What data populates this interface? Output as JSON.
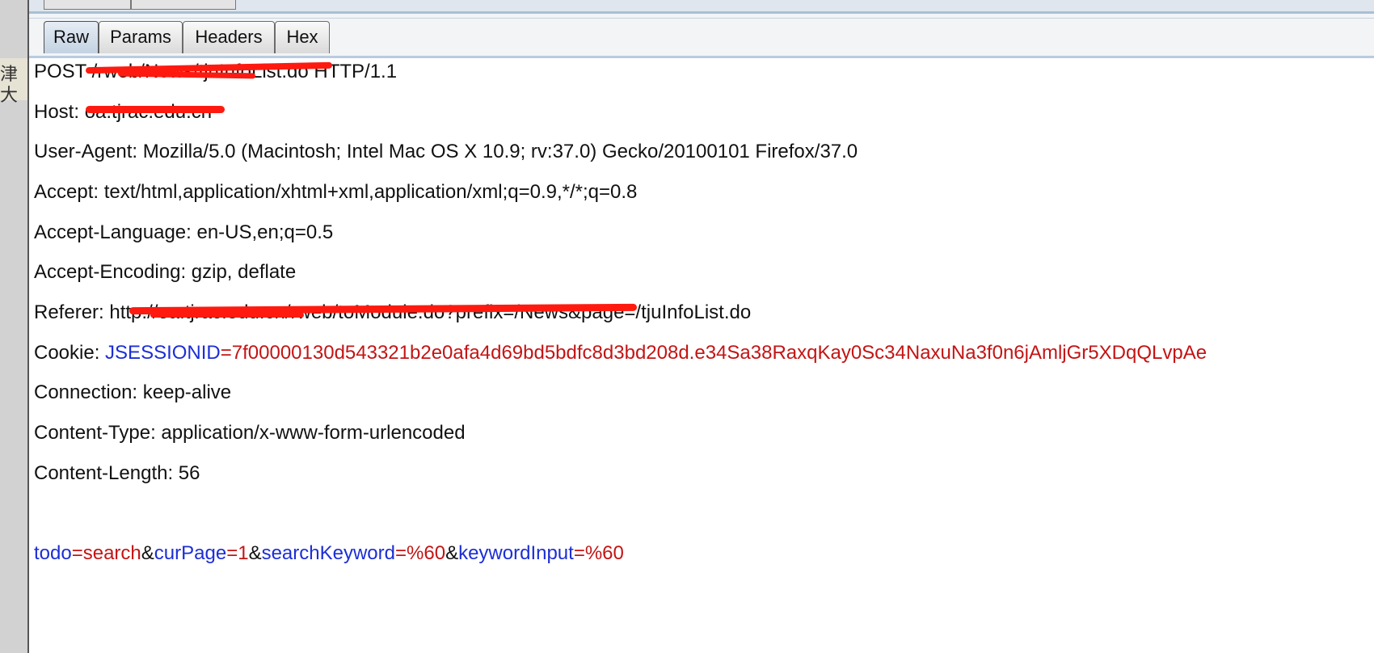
{
  "window": {
    "side_glyph": "津大"
  },
  "tabs": [
    {
      "label": "Raw",
      "active": true
    },
    {
      "label": "Params",
      "active": false
    },
    {
      "label": "Headers",
      "active": false
    },
    {
      "label": "Hex",
      "active": false
    }
  ],
  "request": {
    "request_line": {
      "method": "POST /",
      "redacted": "rweb/News/tju",
      "visible_tail": "InfoList.do HTTP/1.1"
    },
    "host": {
      "name": "Host:",
      "redacted_value": "oa.tjrac.edu.cn"
    },
    "user_agent": "User-Agent: Mozilla/5.0 (Macintosh; Intel Mac OS X 10.9; rv:37.0) Gecko/20100101 Firefox/37.0",
    "accept": "Accept: text/html,application/xhtml+xml,application/xml;q=0.9,*/*;q=0.8",
    "accept_language": "Accept-Language: en-US,en;q=0.5",
    "accept_encoding": "Accept-Encoding: gzip, deflate",
    "referer": {
      "prefix": "Referer: htt",
      "redacted": "p://oa.tjrac.edu.cn/rweb/toModule.do?prefix=/News&pa",
      "suffix": "ge=/tjuInfoList.do"
    },
    "cookie": {
      "name": "Cookie: ",
      "key": "JSESSIONID",
      "eq": "=",
      "value": "7f00000130d543321b2e0afa4d69bd5bdfc8d3bd208d.e34Sa38RaxqKay0Sc34NaxuNa3f0n6jAmljGr5XDqQLvpAe"
    },
    "connection": "Connection: keep-alive",
    "content_type": "Content-Type: application/x-www-form-urlencoded",
    "content_length": "Content-Length: 56",
    "body": [
      {
        "key": "todo",
        "value": "search"
      },
      {
        "key": "curPage",
        "value": "1"
      },
      {
        "key": "searchKeyword",
        "value": "%60"
      },
      {
        "key": "keywordInput",
        "value": "%60"
      }
    ],
    "syntax_colors": {
      "param_key": "#1c2ed6",
      "param_value": "#c41414",
      "text": "#111111"
    }
  },
  "redaction_color": "#ff1a10"
}
